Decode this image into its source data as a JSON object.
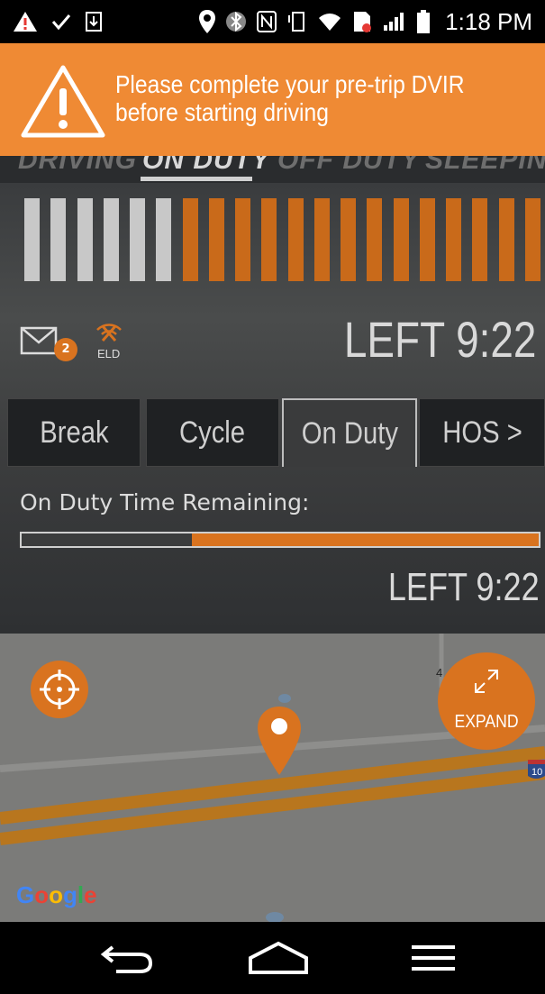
{
  "status_bar": {
    "time": "1:18 PM",
    "icons": [
      "warning-icon",
      "check-icon",
      "download-icon",
      "location-icon",
      "bluetooth-icon",
      "nfc-icon",
      "vibrate-icon",
      "wifi-icon",
      "sim-icon",
      "signal-icon",
      "battery-icon"
    ]
  },
  "alert": {
    "message": "Please complete your pre-trip DVIR before starting driving",
    "icon": "warning-triangle-icon",
    "color": "#EF8A34"
  },
  "duty_tabs": [
    {
      "label": "DRIVING",
      "active": false
    },
    {
      "label": "ON DUTY",
      "active": true
    },
    {
      "label": "OFF DUTY",
      "active": false
    },
    {
      "label": "SLEEPING",
      "active": false
    }
  ],
  "hos_bars": {
    "total": 20,
    "used": 6,
    "used_color": "#C8C8C8",
    "remaining_color": "#C96A1A"
  },
  "messages": {
    "badge_count": "2"
  },
  "eld": {
    "label": "ELD"
  },
  "header_remaining": "LEFT 9:22",
  "tabs": [
    {
      "label": "Break",
      "active": false
    },
    {
      "label": "Cycle",
      "active": false
    },
    {
      "label": "On Duty",
      "active": true
    },
    {
      "label": "HOS >",
      "active": false
    }
  ],
  "on_duty": {
    "label": "On Duty Time Remaining:",
    "remaining_fraction": 0.67,
    "remaining_text": "LEFT 9:22"
  },
  "map": {
    "attribution": "Google",
    "expand_label": "EXPAND",
    "highway_shield": "10",
    "road_label": "4"
  },
  "navbar": {
    "buttons": [
      "back-icon",
      "home-icon",
      "menu-icon"
    ]
  },
  "colors": {
    "accent": "#D9731F",
    "alert": "#EF8A34"
  }
}
